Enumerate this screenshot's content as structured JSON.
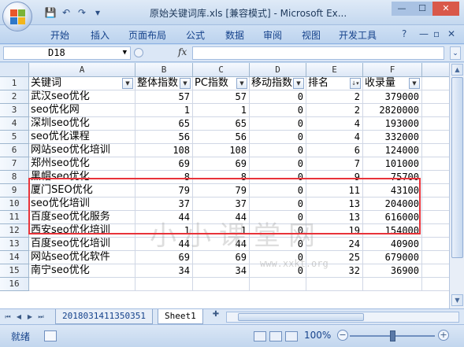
{
  "window": {
    "title": "原始关键词库.xls  [兼容模式] - Microsoft Ex...",
    "qat": {
      "save": "💾",
      "undo": "↶",
      "redo": "↷",
      "customize": "▾"
    }
  },
  "ribbon": {
    "tabs": [
      "开始",
      "插入",
      "页面布局",
      "公式",
      "数据",
      "审阅",
      "视图",
      "开发工具"
    ],
    "help": "?"
  },
  "formula_bar": {
    "name_box": "D18",
    "fx": "fx",
    "content": ""
  },
  "sheet": {
    "columns": [
      "A",
      "B",
      "C",
      "D",
      "E",
      "F"
    ],
    "rows": [
      "1",
      "2",
      "3",
      "4",
      "5",
      "6",
      "7",
      "8",
      "9",
      "10",
      "11",
      "12",
      "13",
      "14",
      "15",
      "16"
    ],
    "header": [
      "关键词",
      "整体指数",
      "PC指数",
      "移动指数",
      "排名",
      "收录量"
    ],
    "data": [
      [
        "武汉seo优化",
        "57",
        "57",
        "0",
        "2",
        "379000"
      ],
      [
        "seo优化网",
        "1",
        "1",
        "0",
        "2",
        "2820000"
      ],
      [
        "深圳seo优化",
        "65",
        "65",
        "0",
        "4",
        "193000"
      ],
      [
        "seo优化课程",
        "56",
        "56",
        "0",
        "4",
        "332000"
      ],
      [
        "网站seo优化培训",
        "108",
        "108",
        "0",
        "6",
        "124000"
      ],
      [
        "郑州seo优化",
        "69",
        "69",
        "0",
        "7",
        "101000"
      ],
      [
        "黑帽seo优化",
        "8",
        "8",
        "0",
        "9",
        "75700"
      ],
      [
        "厦门SEO优化",
        "79",
        "79",
        "0",
        "11",
        "43100"
      ],
      [
        "seo优化培训",
        "37",
        "37",
        "0",
        "13",
        "204000"
      ],
      [
        "百度seo优化服务",
        "44",
        "44",
        "0",
        "13",
        "616000"
      ],
      [
        "西安seo优化培训",
        "1",
        "1",
        "0",
        "19",
        "154000"
      ],
      [
        "百度seo优化培训",
        "44",
        "44",
        "0",
        "24",
        "40900"
      ],
      [
        "网站seo优化软件",
        "69",
        "69",
        "0",
        "25",
        "679000"
      ],
      [
        "南宁seo优化",
        "34",
        "34",
        "0",
        "32",
        "36900"
      ]
    ]
  },
  "watermark": {
    "text": "小小课堂网",
    "url": "www.xxkt.org"
  },
  "sheet_tabs": [
    "20180314113503 51",
    "Sheet1"
  ],
  "sheet_tab_labels": {
    "first": "2018031411350351",
    "second": "Sheet1"
  },
  "status": {
    "ready": "就绪",
    "zoom": "100%",
    "minus": "−",
    "plus": "+"
  },
  "colors": {
    "highlight_box": "#e8333a",
    "ribbon_text": "#15428b"
  }
}
